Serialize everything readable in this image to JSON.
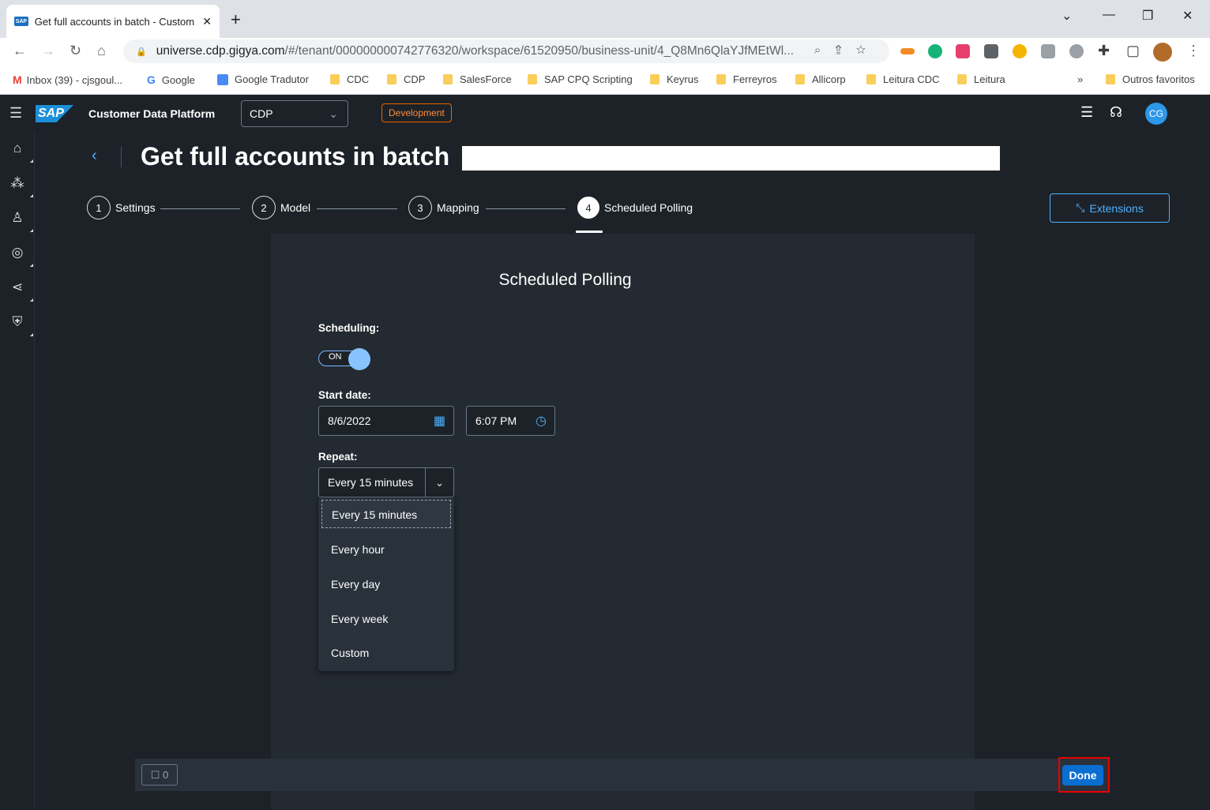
{
  "browser": {
    "tab_title": "Get full accounts in batch - Customer Data Platform",
    "favicon_text": "SAP",
    "url_host": "universe.cdp.gigya.com",
    "url_path": "/#/tenant/000000000742776320/workspace/61520950/business-unit/4_Q8Mn6QlaYJfMEtWl...",
    "bookmarks": [
      {
        "label": "Inbox (39) - cjsgoul...",
        "icon": "gmail-icon"
      },
      {
        "label": "Google",
        "icon": "google-icon"
      },
      {
        "label": "Google Tradutor",
        "icon": "translate-icon"
      },
      {
        "label": "CDC",
        "icon": "folder-icon"
      },
      {
        "label": "CDP",
        "icon": "folder-icon"
      },
      {
        "label": "SalesForce",
        "icon": "folder-icon"
      },
      {
        "label": "SAP CPQ Scripting",
        "icon": "folder-icon"
      },
      {
        "label": "Keyrus",
        "icon": "folder-icon"
      },
      {
        "label": "Ferreyros",
        "icon": "folder-icon"
      },
      {
        "label": "Allicorp",
        "icon": "folder-icon"
      },
      {
        "label": "Leitura CDC",
        "icon": "folder-icon"
      },
      {
        "label": "Leitura",
        "icon": "folder-icon"
      }
    ],
    "bookmarks_overflow": "»",
    "other_bookmarks": "Outros favoritos"
  },
  "shell": {
    "logo_text": "SAP",
    "product_name": "Customer Data Platform",
    "app_selector_value": "CDP",
    "environment_badge": "Development",
    "avatar_initials": "CG"
  },
  "header": {
    "title": "Get full accounts in batch",
    "steps": [
      {
        "number": "1",
        "label": "Settings"
      },
      {
        "number": "2",
        "label": "Model"
      },
      {
        "number": "3",
        "label": "Mapping"
      },
      {
        "number": "4",
        "label": "Scheduled Polling"
      }
    ],
    "extensions_label": "Extensions"
  },
  "form": {
    "section_title": "Scheduled Polling",
    "scheduling_label": "Scheduling:",
    "toggle_text": "ON",
    "start_date_label": "Start date:",
    "start_date_value": "8/6/2022",
    "start_time_value": "6:07 PM",
    "repeat_label": "Repeat:",
    "repeat_value": "Every 15 minutes",
    "repeat_options": [
      "Every 15 minutes",
      "Every hour",
      "Every day",
      "Every week",
      "Custom"
    ]
  },
  "footer": {
    "message_count": "0",
    "done_label": "Done"
  },
  "colors": {
    "accent": "#0a6ed1",
    "link": "#4db1ff",
    "environment": "#e76500",
    "highlight": "#ee0000"
  }
}
